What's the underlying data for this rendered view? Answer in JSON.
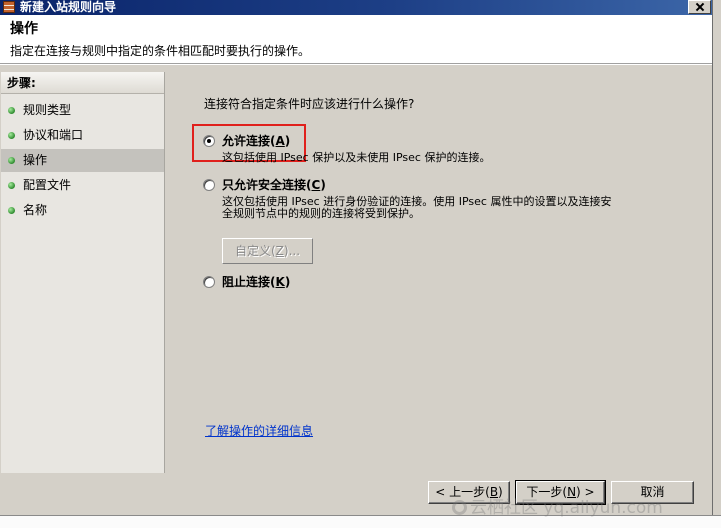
{
  "window": {
    "title": "新建入站规则向导",
    "icon": "firewall-icon",
    "close_icon": "close-icon"
  },
  "header": {
    "title": "操作",
    "subtitle": "指定在连接与规则中指定的条件相匹配时要执行的操作。"
  },
  "steps": {
    "heading": "步骤:",
    "items": [
      {
        "label": "规则类型",
        "selected": false
      },
      {
        "label": "协议和端口",
        "selected": false
      },
      {
        "label": "操作",
        "selected": true
      },
      {
        "label": "配置文件",
        "selected": false
      },
      {
        "label": "名称",
        "selected": false
      }
    ]
  },
  "main": {
    "question": "连接符合指定条件时应该进行什么操作?",
    "options": [
      {
        "label_prefix": "允许连接(",
        "accel": "A",
        "label_suffix": ")",
        "checked": true,
        "description_lines": [
          "这包括使用 IPsec 保护以及未使用 IPsec 保护的连接。"
        ]
      },
      {
        "label_prefix": "只允许安全连接(",
        "accel": "C",
        "label_suffix": ")",
        "checked": false,
        "description_lines": [
          "这仅包括使用 IPsec 进行身份验证的连接。使用 IPsec 属性中的设置以及连接安",
          "全规则节点中的规则的连接将受到保护。"
        ]
      },
      {
        "label_prefix": "阻止连接(",
        "accel": "K",
        "label_suffix": ")",
        "checked": false,
        "description_lines": []
      }
    ],
    "customize_button": {
      "prefix": "自定义(",
      "accel": "Z",
      "suffix": ")...",
      "enabled": false
    },
    "help_link": "了解操作的详细信息"
  },
  "footer": {
    "back": {
      "prefix": "< 上一步(",
      "accel": "B",
      "suffix": ")"
    },
    "next": {
      "prefix": "下一步(",
      "accel": "N",
      "suffix": ") >"
    },
    "cancel": "取消"
  },
  "watermark": {
    "text": "云栖社区 yq.aliyun.com"
  },
  "colors": {
    "title_bar": "#0a246a",
    "dialog_bg": "#d4d0c8",
    "link": "#0033cc",
    "highlight_box": "#e0201c",
    "step_bullet": "#2e8b2e"
  }
}
